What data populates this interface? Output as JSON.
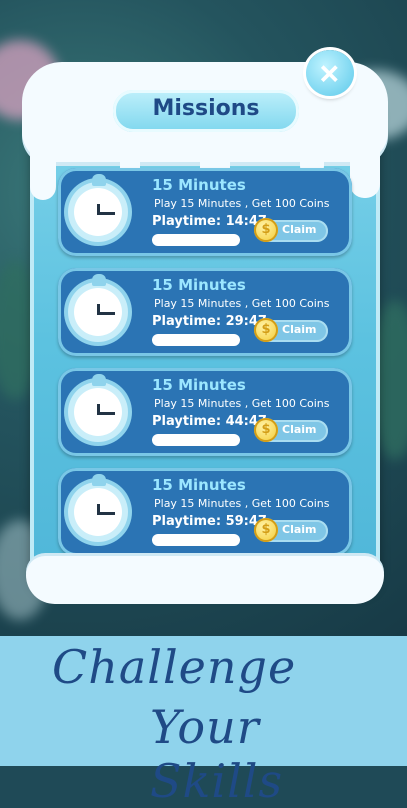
{
  "header": {
    "title": "Missions",
    "close_icon": "close-icon"
  },
  "missions": [
    {
      "title": "15 Minutes",
      "description": "Play 15 Minutes , Get 100 Coins",
      "playtime": "Playtime: 14:47",
      "claim_label": "Claim",
      "icon": "clock-icon",
      "coin_icon": "coin-icon"
    },
    {
      "title": "15 Minutes",
      "description": "Play 15 Minutes , Get 100 Coins",
      "playtime": "Playtime: 29:47",
      "claim_label": "Claim",
      "icon": "clock-icon",
      "coin_icon": "coin-icon"
    },
    {
      "title": "15 Minutes",
      "description": "Play 15 Minutes , Get 100 Coins",
      "playtime": "Playtime: 44:47",
      "claim_label": "Claim",
      "icon": "clock-icon",
      "coin_icon": "coin-icon"
    },
    {
      "title": "15 Minutes",
      "description": "Play 15 Minutes , Get 100 Coins",
      "playtime": "Playtime: 59:47",
      "claim_label": "Claim",
      "icon": "clock-icon",
      "coin_icon": "coin-icon"
    }
  ],
  "banner": {
    "line1": "Challenge",
    "line2": "Your Skills"
  },
  "colors": {
    "card_bg": "#2b74b4",
    "accent_title": "#9be6ff",
    "banner_bg": "#8fd3ec",
    "banner_text": "#1f4a86"
  }
}
